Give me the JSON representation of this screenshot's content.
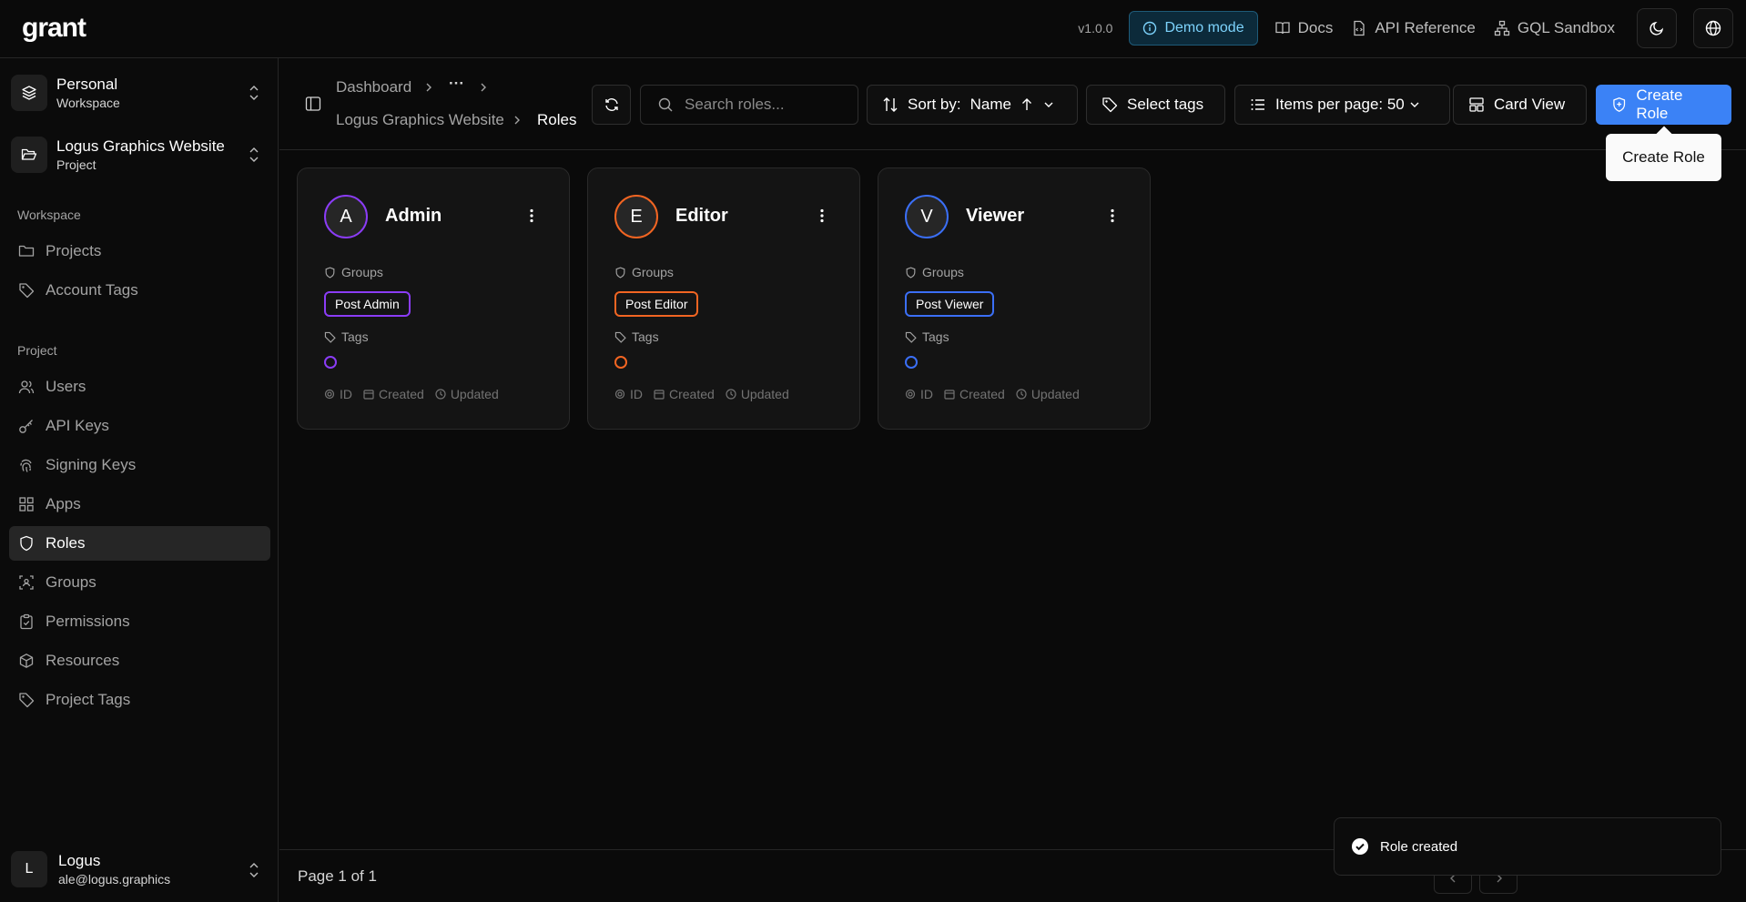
{
  "app": {
    "logo": "grant",
    "version": "v1.0.0"
  },
  "topbar": {
    "demo_label": "Demo mode",
    "links": [
      {
        "label": "Docs",
        "icon": "book-icon"
      },
      {
        "label": "API Reference",
        "icon": "file-code-icon"
      },
      {
        "label": "GQL Sandbox",
        "icon": "network-icon"
      }
    ]
  },
  "sidebar": {
    "workspace_switcher": {
      "title": "Personal",
      "subtitle": "Workspace"
    },
    "project_switcher": {
      "title": "Logus Graphics Website",
      "subtitle": "Project"
    },
    "workspace_section": "Workspace",
    "workspace_items": [
      {
        "label": "Projects",
        "icon": "folder-icon"
      },
      {
        "label": "Account Tags",
        "icon": "tag-icon"
      }
    ],
    "project_section": "Project",
    "project_items": [
      {
        "label": "Users",
        "icon": "users-icon"
      },
      {
        "label": "API Keys",
        "icon": "key-icon"
      },
      {
        "label": "Signing Keys",
        "icon": "fingerprint-icon"
      },
      {
        "label": "Apps",
        "icon": "grid-icon"
      },
      {
        "label": "Roles",
        "icon": "shield-icon",
        "active": true
      },
      {
        "label": "Groups",
        "icon": "group-icon"
      },
      {
        "label": "Permissions",
        "icon": "clipboard-check-icon"
      },
      {
        "label": "Resources",
        "icon": "box-icon"
      },
      {
        "label": "Project Tags",
        "icon": "tag-icon"
      }
    ],
    "user": {
      "initial": "L",
      "name": "Logus",
      "email": "ale@logus.graphics"
    }
  },
  "header": {
    "breadcrumb": {
      "dashboard": "Dashboard",
      "ellipsis": "···",
      "project": "Logus Graphics Website",
      "current": "Roles"
    },
    "search_placeholder": "Search roles...",
    "sort_label": "Sort by:",
    "sort_value": "Name",
    "tags_label": "Select tags",
    "per_page_label": "Items per page: 50",
    "view_label": "Card View",
    "create_label": "Create Role",
    "tooltip": "Create Role"
  },
  "colors": {
    "admin": "#8b3cf6",
    "editor": "#f26522",
    "viewer": "#3b6ff6",
    "accent": "#3b82f6"
  },
  "roles": [
    {
      "initial": "A",
      "name": "Admin",
      "groups_label": "Groups",
      "group": "Post Admin",
      "tags_label": "Tags",
      "meta_id": "ID",
      "meta_created": "Created",
      "meta_updated": "Updated"
    },
    {
      "initial": "E",
      "name": "Editor",
      "groups_label": "Groups",
      "group": "Post Editor",
      "tags_label": "Tags",
      "meta_id": "ID",
      "meta_created": "Created",
      "meta_updated": "Updated"
    },
    {
      "initial": "V",
      "name": "Viewer",
      "groups_label": "Groups",
      "group": "Post Viewer",
      "tags_label": "Tags",
      "meta_id": "ID",
      "meta_created": "Created",
      "meta_updated": "Updated"
    }
  ],
  "footer": {
    "page_label": "Page 1 of 1"
  },
  "toast": {
    "message": "Role created"
  }
}
